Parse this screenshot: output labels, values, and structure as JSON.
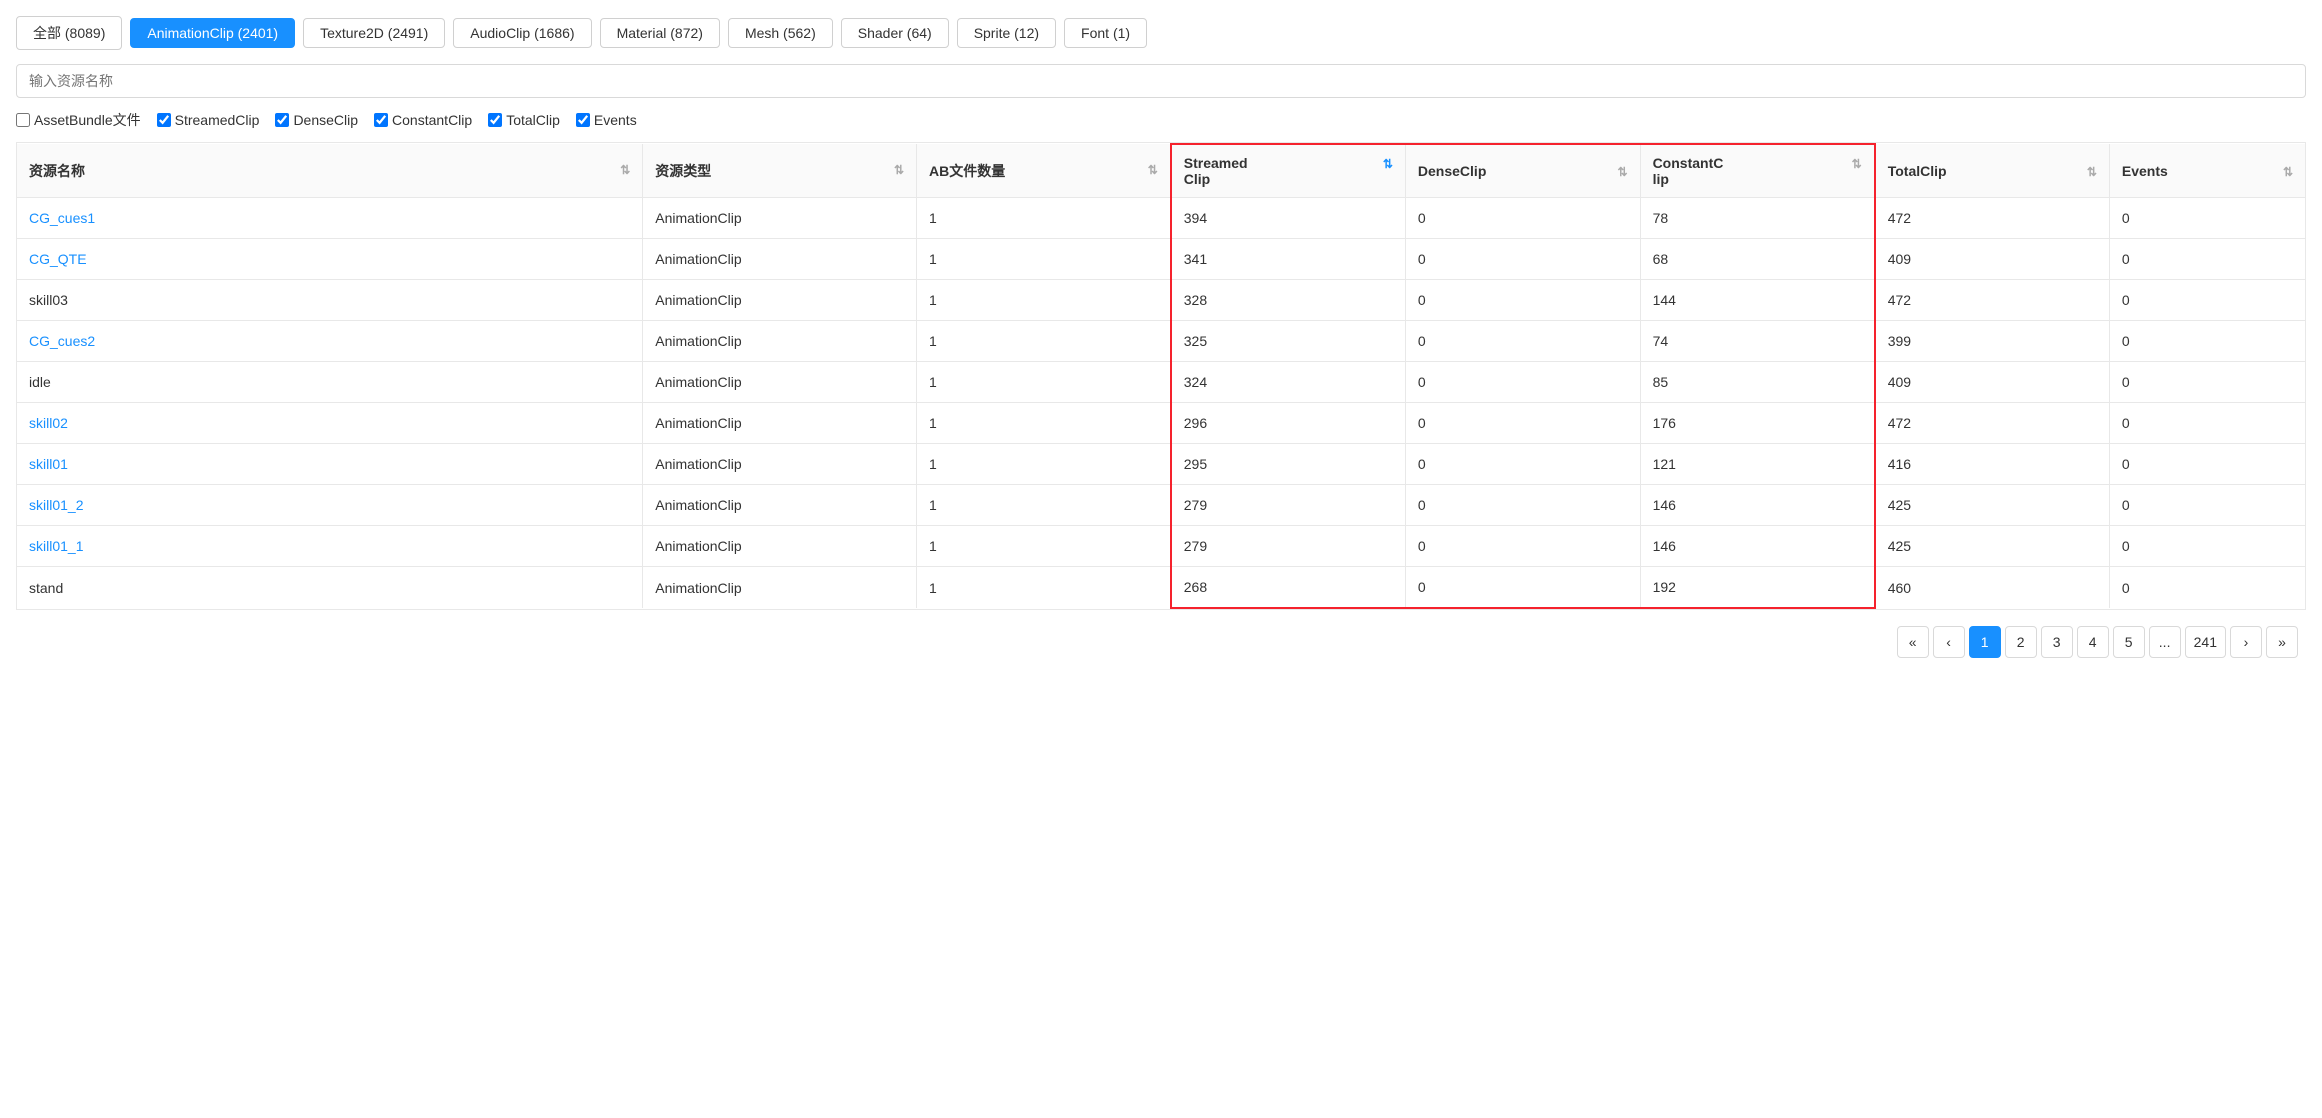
{
  "filterButtons": [
    {
      "label": "全部 (8089)",
      "active": false
    },
    {
      "label": "AnimationClip (2401)",
      "active": true
    },
    {
      "label": "Texture2D (2491)",
      "active": false
    },
    {
      "label": "AudioClip (1686)",
      "active": false
    },
    {
      "label": "Material (872)",
      "active": false
    },
    {
      "label": "Mesh (562)",
      "active": false
    },
    {
      "label": "Shader (64)",
      "active": false
    },
    {
      "label": "Sprite (12)",
      "active": false
    },
    {
      "label": "Font (1)",
      "active": false
    }
  ],
  "searchPlaceholder": "输入资源名称",
  "checkboxes": [
    {
      "label": "AssetBundle文件",
      "checked": false
    },
    {
      "label": "StreamedClip",
      "checked": true
    },
    {
      "label": "DenseClip",
      "checked": true
    },
    {
      "label": "ConstantClip",
      "checked": true
    },
    {
      "label": "TotalClip",
      "checked": true
    },
    {
      "label": "Events",
      "checked": true
    }
  ],
  "columns": [
    {
      "key": "name",
      "label": "资源名称",
      "sortable": true
    },
    {
      "key": "type",
      "label": "资源类型",
      "sortable": true
    },
    {
      "key": "ab",
      "label": "AB文件数量",
      "sortable": true
    },
    {
      "key": "streamed",
      "label": "Streamed\nClip",
      "sortable": true,
      "highlight": true
    },
    {
      "key": "dense",
      "label": "DenseClip",
      "sortable": true,
      "highlight": true
    },
    {
      "key": "constant",
      "label": "ConstantC\nlip",
      "sortable": true,
      "highlight": true
    },
    {
      "key": "total",
      "label": "TotalClip",
      "sortable": true
    },
    {
      "key": "events",
      "label": "Events",
      "sortable": true
    }
  ],
  "rows": [
    {
      "name": "CG_cues1",
      "type": "AnimationClip",
      "ab": "1",
      "streamed": "394",
      "dense": "0",
      "constant": "78",
      "total": "472",
      "events": "0",
      "isLink": true
    },
    {
      "name": "CG_QTE",
      "type": "AnimationClip",
      "ab": "1",
      "streamed": "341",
      "dense": "0",
      "constant": "68",
      "total": "409",
      "events": "0",
      "isLink": true
    },
    {
      "name": "skill03",
      "type": "AnimationClip",
      "ab": "1",
      "streamed": "328",
      "dense": "0",
      "constant": "144",
      "total": "472",
      "events": "0",
      "isLink": false
    },
    {
      "name": "CG_cues2",
      "type": "AnimationClip",
      "ab": "1",
      "streamed": "325",
      "dense": "0",
      "constant": "74",
      "total": "399",
      "events": "0",
      "isLink": true
    },
    {
      "name": "idle",
      "type": "AnimationClip",
      "ab": "1",
      "streamed": "324",
      "dense": "0",
      "constant": "85",
      "total": "409",
      "events": "0",
      "isLink": false
    },
    {
      "name": "skill02",
      "type": "AnimationClip",
      "ab": "1",
      "streamed": "296",
      "dense": "0",
      "constant": "176",
      "total": "472",
      "events": "0",
      "isLink": true
    },
    {
      "name": "skill01",
      "type": "AnimationClip",
      "ab": "1",
      "streamed": "295",
      "dense": "0",
      "constant": "121",
      "total": "416",
      "events": "0",
      "isLink": true
    },
    {
      "name": "skill01_2",
      "type": "AnimationClip",
      "ab": "1",
      "streamed": "279",
      "dense": "0",
      "constant": "146",
      "total": "425",
      "events": "0",
      "isLink": true
    },
    {
      "name": "skill01_1",
      "type": "AnimationClip",
      "ab": "1",
      "streamed": "279",
      "dense": "0",
      "constant": "146",
      "total": "425",
      "events": "0",
      "isLink": true
    },
    {
      "name": "stand",
      "type": "AnimationClip",
      "ab": "1",
      "streamed": "268",
      "dense": "0",
      "constant": "192",
      "total": "460",
      "events": "0",
      "isLink": false
    }
  ],
  "pagination": {
    "first": "«",
    "prev": "‹",
    "pages": [
      "1",
      "2",
      "3",
      "4",
      "5",
      "...",
      "241"
    ],
    "next": "›",
    "last": "»",
    "activePage": "1"
  }
}
